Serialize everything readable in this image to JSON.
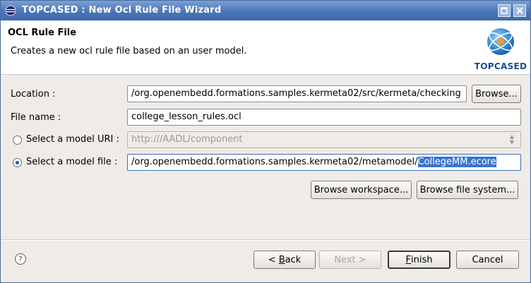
{
  "window": {
    "title": "TOPCASED : New Ocl Rule File Wizard"
  },
  "header": {
    "title": "OCL Rule File",
    "description": "Creates a new ocl rule file based on an user model.",
    "logo_text": "TOPCASED"
  },
  "form": {
    "location_label": "Location :",
    "location_value": "/org.openembedd.formations.samples.kermeta02/src/kermeta/checking",
    "browse_label": "Browse...",
    "filename_label": "File name :",
    "filename_value": "college_lesson_rules.ocl",
    "model_uri_label": "Select a model URI :",
    "model_uri_value": "http:///AADL/component",
    "model_file_label": "Select a model file :",
    "model_file_value_prefix": "/org.openembedd.formations.samples.kermeta02/metamodel/",
    "model_file_value_selected": "CollegeMM.ecore",
    "browse_workspace_label": "Browse workspace...",
    "browse_filesystem_label": "Browse file system..."
  },
  "footer": {
    "back_prefix": "< ",
    "back_mnemonic": "B",
    "back_rest": "ack",
    "next_label": "Next >",
    "finish_mnemonic": "F",
    "finish_rest": "inish",
    "cancel_label": "Cancel"
  },
  "colors": {
    "titlebar": "#4a76b8",
    "selection": "#3874d0"
  }
}
